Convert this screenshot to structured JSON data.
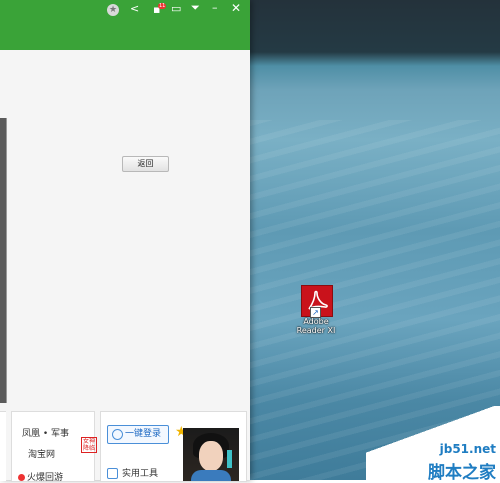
{
  "titlebar": {
    "badge_count": "11",
    "icons": [
      "settings-icon",
      "share-icon",
      "message-icon",
      "chat-icon",
      "dropdown-icon",
      "minimize-icon",
      "close-icon"
    ]
  },
  "back_button": {
    "label": "返回"
  },
  "news": {
    "items": [
      "凤凰 • 军事",
      "淘宝网",
      "火爆回游"
    ],
    "hot_tag": "女神 降临"
  },
  "login": {
    "button_label": "一键登录",
    "tools_label": "实用工具"
  },
  "desktop_icon": {
    "label_line1": "Adobe",
    "label_line2": "Reader XI"
  },
  "watermark": {
    "site": "jb51.net",
    "name": "脚本之家"
  },
  "colors": {
    "titlebar": "#3aa338",
    "pdf_red": "#c9121b",
    "watermark_blue": "#1f7dc2"
  }
}
